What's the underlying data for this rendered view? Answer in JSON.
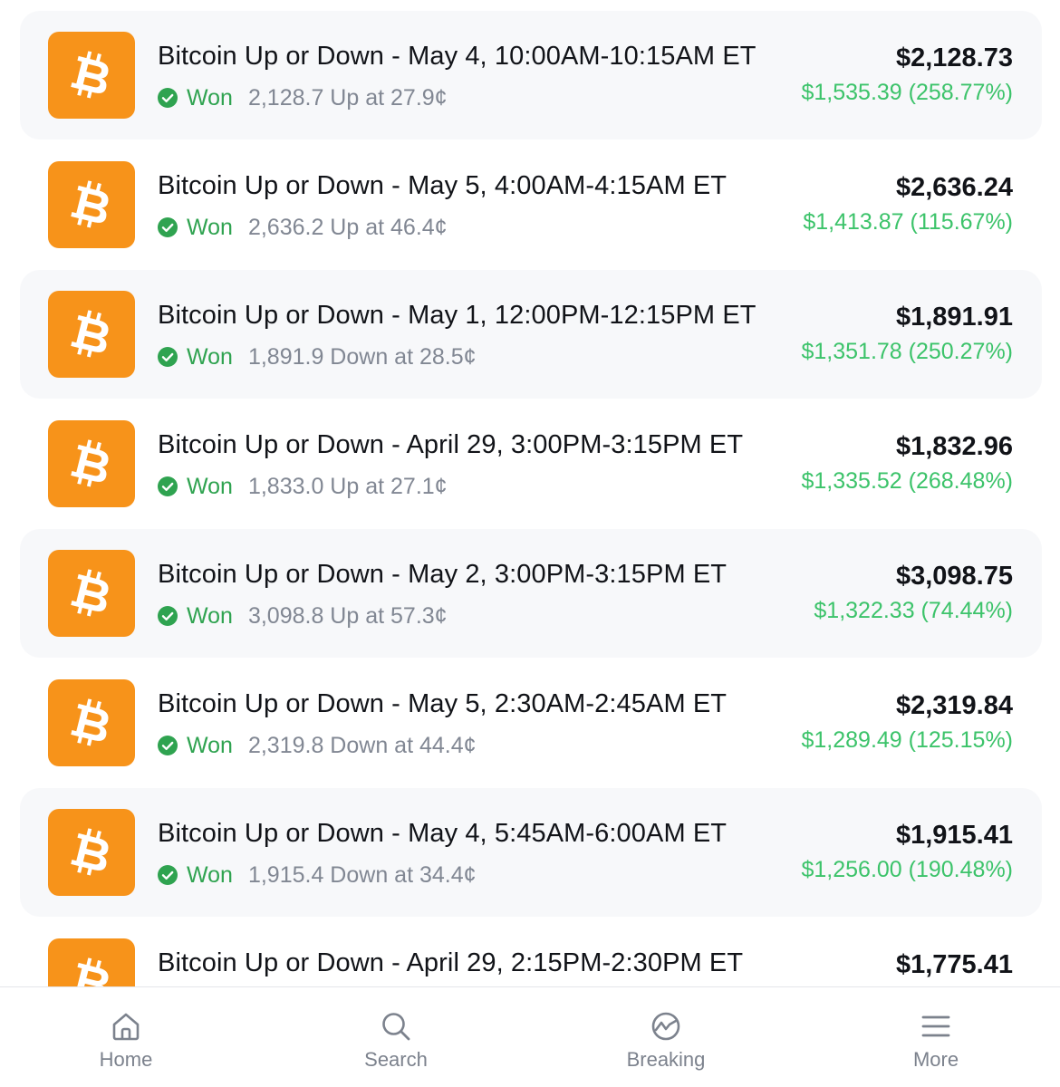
{
  "rows": [
    {
      "title": "Bitcoin Up or Down - May 4, 10:00AM-10:15AM ET",
      "status": "Won",
      "detail": "2,128.7 Up at 27.9¢",
      "amount": "$2,128.73",
      "profit": "$1,535.39 (258.77%)"
    },
    {
      "title": "Bitcoin Up or Down - May 5, 4:00AM-4:15AM ET",
      "status": "Won",
      "detail": "2,636.2 Up at 46.4¢",
      "amount": "$2,636.24",
      "profit": "$1,413.87 (115.67%)"
    },
    {
      "title": "Bitcoin Up or Down - May 1, 12:00PM-12:15PM ET",
      "status": "Won",
      "detail": "1,891.9 Down at 28.5¢",
      "amount": "$1,891.91",
      "profit": "$1,351.78 (250.27%)"
    },
    {
      "title": "Bitcoin Up or Down - April 29, 3:00PM-3:15PM ET",
      "status": "Won",
      "detail": "1,833.0 Up at 27.1¢",
      "amount": "$1,832.96",
      "profit": "$1,335.52 (268.48%)"
    },
    {
      "title": "Bitcoin Up or Down - May 2, 3:00PM-3:15PM ET",
      "status": "Won",
      "detail": "3,098.8 Up at 57.3¢",
      "amount": "$3,098.75",
      "profit": "$1,322.33 (74.44%)"
    },
    {
      "title": "Bitcoin Up or Down - May 5, 2:30AM-2:45AM ET",
      "status": "Won",
      "detail": "2,319.8 Down at 44.4¢",
      "amount": "$2,319.84",
      "profit": "$1,289.49 (125.15%)"
    },
    {
      "title": "Bitcoin Up or Down - May 4, 5:45AM-6:00AM ET",
      "status": "Won",
      "detail": "1,915.4 Down at 34.4¢",
      "amount": "$1,915.41",
      "profit": "$1,256.00 (190.48%)"
    },
    {
      "title": "Bitcoin Up or Down - April 29, 2:15PM-2:30PM ET",
      "status": "",
      "detail": "",
      "amount": "$1,775.41",
      "profit": ""
    }
  ],
  "nav": {
    "home": {
      "label": "Home",
      "icon": "home-icon"
    },
    "search": {
      "label": "Search",
      "icon": "search-icon"
    },
    "breaking": {
      "label": "Breaking",
      "icon": "breaking-icon"
    },
    "more": {
      "label": "More",
      "icon": "menu-icon"
    }
  },
  "colors": {
    "coin": "#f7931a",
    "won": "#2fa350",
    "profit": "#3cc36a",
    "row_shade": "#f7f8fa"
  }
}
